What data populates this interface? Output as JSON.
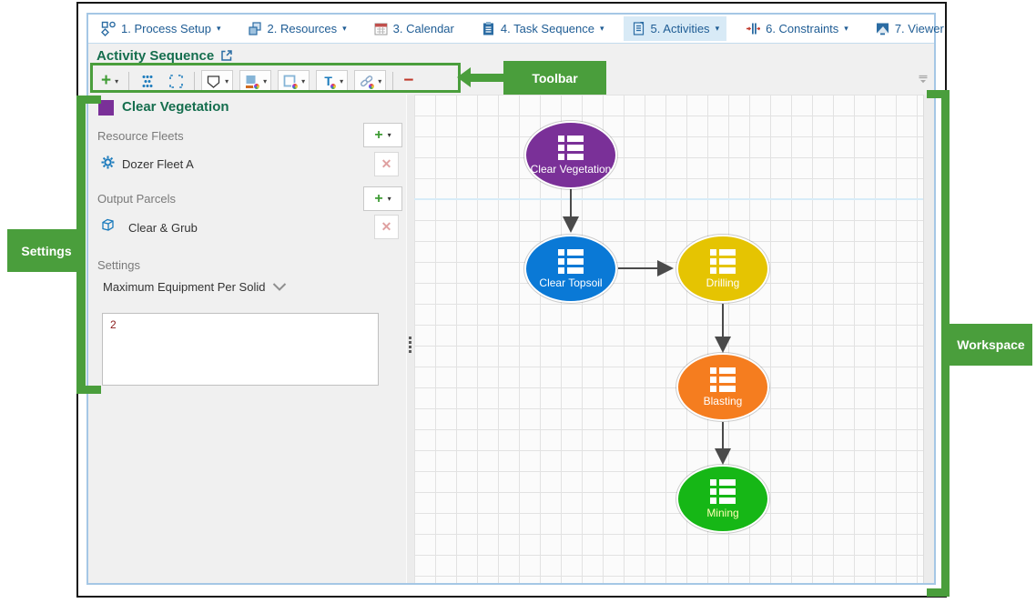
{
  "tabs": [
    {
      "label": "1. Process Setup",
      "has_dropdown": true,
      "active": false
    },
    {
      "label": "2. Resources",
      "has_dropdown": true,
      "active": false
    },
    {
      "label": "3. Calendar",
      "has_dropdown": false,
      "active": false
    },
    {
      "label": "4. Task Sequence",
      "has_dropdown": true,
      "active": false
    },
    {
      "label": "5. Activities",
      "has_dropdown": true,
      "active": true
    },
    {
      "label": "6. Constraints",
      "has_dropdown": true,
      "active": false
    },
    {
      "label": "7. Viewer",
      "has_dropdown": false,
      "active": false
    }
  ],
  "header": {
    "title": "Activity Sequence"
  },
  "glyphs": {
    "caret": "▾",
    "plus": "+",
    "minus": "−",
    "x": "✕"
  },
  "annotations": {
    "toolbar_label": "Toolbar",
    "settings_label": "Settings",
    "workspace_label": "Workspace",
    "color": "#4a9e3c"
  },
  "settings_panel": {
    "title": "Clear Vegetation",
    "swatch_color": "#7a3098",
    "resource_fleets": {
      "label": "Resource Fleets",
      "items": [
        {
          "name": "Dozer Fleet A",
          "icon": "gear-icon"
        }
      ]
    },
    "output_parcels": {
      "label": "Output Parcels",
      "items": [
        {
          "name": "Clear & Grub",
          "icon": "cube-icon"
        }
      ]
    },
    "settings_label": "Settings",
    "setting_dropdown": "Maximum Equipment Per Solid",
    "setting_value": "2"
  },
  "workspace": {
    "nodes": [
      {
        "label": "Clear Vegetation",
        "color": "#7a3098"
      },
      {
        "label": "Clear Topsoil",
        "color": "#0a79d6"
      },
      {
        "label": "Drilling",
        "color": "#e5c402"
      },
      {
        "label": "Blasting",
        "color": "#f57d1f"
      },
      {
        "label": "Mining",
        "color": "#16b716"
      }
    ],
    "edges": [
      {
        "from": "Clear Vegetation",
        "to": "Clear Topsoil"
      },
      {
        "from": "Clear Topsoil",
        "to": "Drilling"
      },
      {
        "from": "Drilling",
        "to": "Blasting"
      },
      {
        "from": "Blasting",
        "to": "Mining"
      }
    ]
  }
}
